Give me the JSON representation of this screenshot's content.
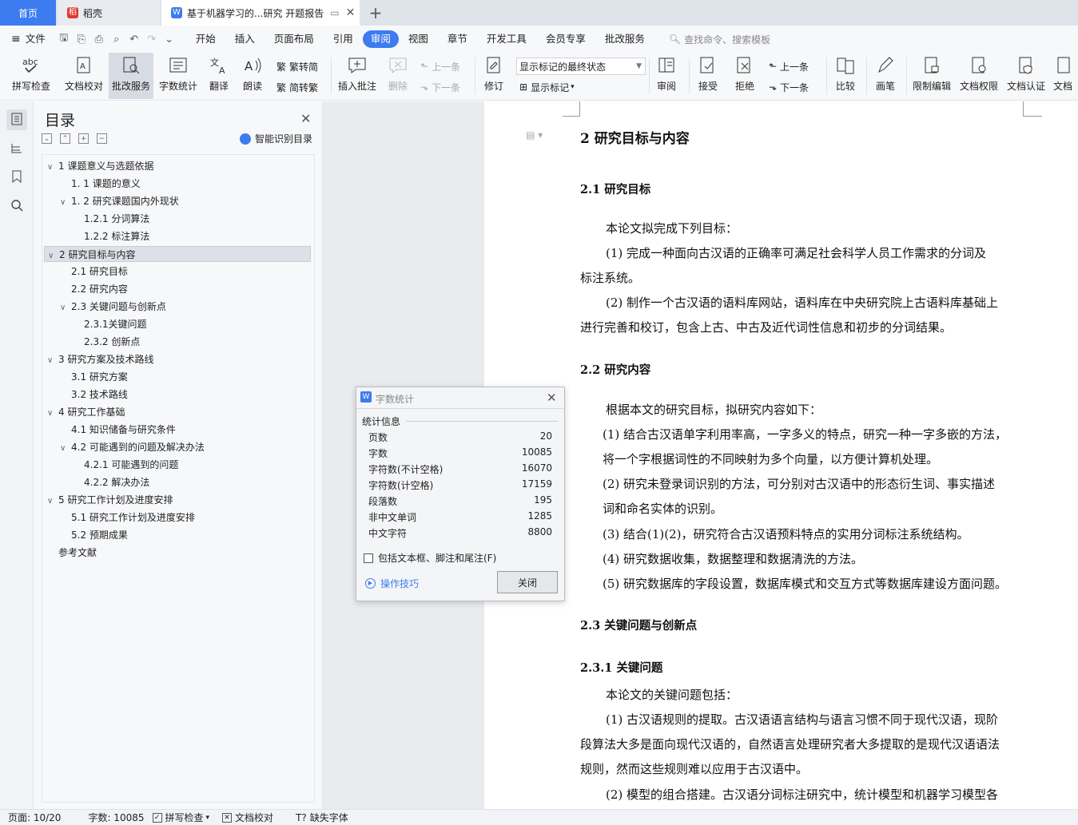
{
  "tabs": {
    "home": "首页",
    "daoke": "稻壳",
    "doc": "基于机器学习的...研究 开题报告"
  },
  "menu": {
    "file": "文件",
    "items": [
      "开始",
      "插入",
      "页面布局",
      "引用",
      "审阅",
      "视图",
      "章节",
      "开发工具",
      "会员专享",
      "批改服务"
    ],
    "active_index": 4,
    "search": "查找命令、搜索模板"
  },
  "ribbon": {
    "spell": "拼写检查",
    "proofread": "文档校对",
    "review_service": "批改服务",
    "word_count": "字数统计",
    "translate": "翻译",
    "read_aloud": "朗读",
    "to_trad": "繁转简",
    "to_simp": "简转繁",
    "insert_comment": "插入批注",
    "delete": "删除",
    "prev": "上一条",
    "next": "下一条",
    "track": "修订",
    "markup_state": "显示标记的最终状态",
    "show_markup": "显示标记",
    "review": "审阅",
    "accept": "接受",
    "reject": "拒绝",
    "prev2": "上一条",
    "next2": "下一条",
    "compare": "比较",
    "pen": "画笔",
    "restrict": "限制编辑",
    "permission": "文档权限",
    "certify": "文档认证",
    "more": "文档"
  },
  "toc": {
    "title": "目录",
    "smart": "智能识别目录",
    "items": [
      {
        "label": "1  课题意义与选题依据",
        "level": 0,
        "caret": "v"
      },
      {
        "label": "1. 1 课题的意义",
        "level": 1,
        "caret": ""
      },
      {
        "label": "1. 2 研究课题国内外现状",
        "level": 1,
        "caret": "v"
      },
      {
        "label": "1.2.1 分词算法",
        "level": 2,
        "caret": ""
      },
      {
        "label": "1.2.2 标注算法",
        "level": 2,
        "caret": ""
      },
      {
        "label": "2 研究目标与内容",
        "level": 0,
        "caret": "v"
      },
      {
        "label": "2.1 研究目标",
        "level": 1,
        "caret": ""
      },
      {
        "label": "2.2 研究内容",
        "level": 1,
        "caret": ""
      },
      {
        "label": "2.3  关键问题与创新点",
        "level": 1,
        "caret": "v"
      },
      {
        "label": "2.3.1关键问题",
        "level": 2,
        "caret": ""
      },
      {
        "label": "2.3.2  创新点",
        "level": 2,
        "caret": ""
      },
      {
        "label": "3 研究方案及技术路线",
        "level": 0,
        "caret": "v"
      },
      {
        "label": "3.1 研究方案",
        "level": 1,
        "caret": ""
      },
      {
        "label": "3.2 技术路线",
        "level": 1,
        "caret": ""
      },
      {
        "label": "4 研究工作基础",
        "level": 0,
        "caret": "v"
      },
      {
        "label": "4.1 知识储备与研究条件",
        "level": 1,
        "caret": ""
      },
      {
        "label": "4.2 可能遇到的问题及解决办法",
        "level": 1,
        "caret": "v"
      },
      {
        "label": "4.2.1  可能遇到的问题",
        "level": 2,
        "caret": ""
      },
      {
        "label": "4.2.2  解决办法",
        "level": 2,
        "caret": ""
      },
      {
        "label": "5 研究工作计划及进度安排",
        "level": 0,
        "caret": "v"
      },
      {
        "label": "5.1 研究工作计划及进度安排",
        "level": 1,
        "caret": ""
      },
      {
        "label": "5.2 预期成果",
        "level": 1,
        "caret": ""
      },
      {
        "label": "参考文献",
        "level": 0,
        "caret": ""
      }
    ],
    "selected_index": 5
  },
  "document": {
    "lines": [
      {
        "t": "2 研究目标与内容",
        "c": "h1"
      },
      {
        "t": "2.1 研究目标",
        "c": "h2"
      },
      {
        "t": "本论文拟完成下列目标：",
        "c": "p"
      },
      {
        "t": "(1)  完成一种面向古汉语的正确率可满足社会科学人员工作需求的分词及",
        "c": "p"
      },
      {
        "t": "标注系统。",
        "c": "p"
      },
      {
        "t": "(2)  制作一个古汉语的语料库网站，语料库在中央研究院上古语料库基础上",
        "c": "p"
      },
      {
        "t": "进行完善和校订，包含上古、中古及近代词性信息和初步的分词结果。",
        "c": "p"
      },
      {
        "t": "2.2 研究内容",
        "c": "h2"
      },
      {
        "t": "根据本文的研究目标，拟研究内容如下：",
        "c": "p"
      },
      {
        "t": "(1)  结合古汉语单字利用率高，一字多义的特点，研究一种一字多嵌的方法，",
        "c": "p"
      },
      {
        "t": "将一个字根据词性的不同映射为多个向量，以方便计算机处理。",
        "c": "p"
      },
      {
        "t": "(2)  研究未登录词识别的方法，可分别对古汉语中的形态衍生词、事实描述",
        "c": "p"
      },
      {
        "t": "词和命名实体的识别。",
        "c": "p"
      },
      {
        "t": "(3)  结合(1)(2)，研究符合古汉语预料特点的实用分词标注系统结构。",
        "c": "p"
      },
      {
        "t": "(4)  研究数据收集，数据整理和数据清洗的方法。",
        "c": "p"
      },
      {
        "t": "(5)  研究数据库的字段设置，数据库模式和交互方式等数据库建设方面问题。",
        "c": "p"
      },
      {
        "t": "2.3  关键问题与创新点",
        "c": "h2"
      },
      {
        "t": "2.3.1    关键问题",
        "c": "h2"
      },
      {
        "t": "本论文的关键问题包括：",
        "c": "p"
      },
      {
        "t": "(1)  古汉语规则的提取。古汉语语言结构与语言习惯不同于现代汉语，现阶",
        "c": "p"
      },
      {
        "t": "段算法大多是面向现代汉语的，自然语言处理研究者大多提取的是现代汉语语法",
        "c": "p"
      },
      {
        "t": "规则，然而这些规则难以应用于古汉语中。",
        "c": "p"
      },
      {
        "t": "(2)  模型的组合搭建。古汉语分词标注研究中，统计模型和机器学习模型各",
        "c": "p"
      }
    ]
  },
  "dialog": {
    "title": "字数统计",
    "section": "统计信息",
    "rows": [
      {
        "k": "页数",
        "v": "20"
      },
      {
        "k": "字数",
        "v": "10085"
      },
      {
        "k": "字符数(不计空格)",
        "v": "16070"
      },
      {
        "k": "字符数(计空格)",
        "v": "17159"
      },
      {
        "k": "段落数",
        "v": "195"
      },
      {
        "k": "非中文单词",
        "v": "1285"
      },
      {
        "k": "中文字符",
        "v": "8800"
      }
    ],
    "checkbox": "包括文本框、脚注和尾注(F)",
    "tips": "操作技巧",
    "close": "关闭"
  },
  "status": {
    "page": "页面: 10/20",
    "words": "字数: 10085",
    "spell": "拼写检查",
    "proof": "文档校对",
    "font": "缺失字体"
  },
  "colors": {
    "accent": "#3c7bf0"
  }
}
